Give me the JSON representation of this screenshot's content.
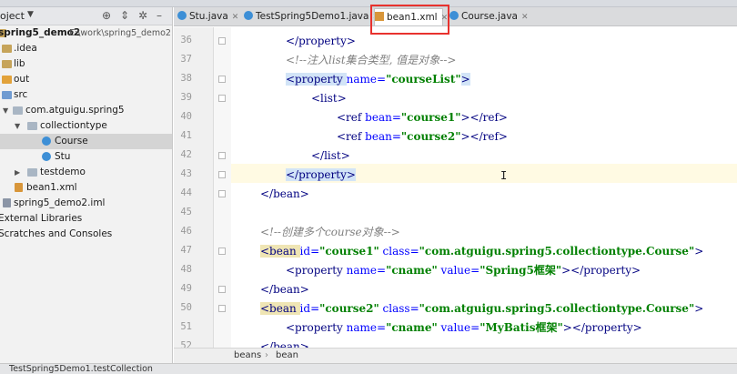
{
  "project_panel": {
    "title": "oject",
    "tree": [
      {
        "label": "spring5_demo2",
        "path": "E:\\work\\spring5_demo2",
        "icon": "folder-icon",
        "bold": true
      },
      {
        "label": ".idea",
        "icon": "folder-icon"
      },
      {
        "label": "lib",
        "icon": "folder-icon"
      },
      {
        "label": "out",
        "icon": "folder-icon"
      },
      {
        "label": "src",
        "icon": "folder-icon"
      },
      {
        "label": "com.atguigu.spring5",
        "icon": "package-icon"
      },
      {
        "label": "collectiontype",
        "icon": "package-icon"
      },
      {
        "label": "Course",
        "icon": "class-icon",
        "selected": true
      },
      {
        "label": "Stu",
        "icon": "class-icon"
      },
      {
        "label": "testdemo",
        "icon": "package-icon"
      },
      {
        "label": "bean1.xml",
        "icon": "xml-file-icon"
      },
      {
        "label": "spring5_demo2.iml",
        "icon": "iml-file-icon"
      },
      {
        "label": "External Libraries",
        "icon": "library-icon"
      },
      {
        "label": "Scratches and Consoles",
        "icon": "scratch-icon"
      }
    ]
  },
  "tabs": [
    {
      "label": "Stu.java",
      "icon": "class-icon",
      "active": false
    },
    {
      "label": "TestSpring5Demo1.java",
      "icon": "class-icon",
      "active": false
    },
    {
      "label": "bean1.xml",
      "icon": "xml-file-icon",
      "active": true
    },
    {
      "label": "Course.java",
      "icon": "class-icon",
      "active": false
    }
  ],
  "editor": {
    "lines": [
      {
        "n": "36",
        "text": "</property>"
      },
      {
        "n": "37",
        "text": "<!--注入list集合类型, 值是对象-->"
      },
      {
        "n": "38",
        "pre": "<property ",
        "attr": "name=",
        "val": "\"courseList\"",
        "post": ">"
      },
      {
        "n": "39",
        "text": "<list>"
      },
      {
        "n": "40",
        "pre": "<ref ",
        "attr": "bean=",
        "val": "\"course1\"",
        "post": "></ref>"
      },
      {
        "n": "41",
        "pre": "<ref ",
        "attr": "bean=",
        "val": "\"course2\"",
        "post": "></ref>"
      },
      {
        "n": "42",
        "text": "</list>"
      },
      {
        "n": "43",
        "text": "</property>"
      },
      {
        "n": "44",
        "text": "</bean>"
      },
      {
        "n": "45",
        "text": ""
      },
      {
        "n": "46",
        "text": "<!--创建多个course对象-->"
      },
      {
        "n": "47",
        "pre": "<bean ",
        "attr": "id=",
        "val": "\"course1\"",
        "attr2": " class=",
        "val2": "\"com.atguigu.spring5.collectiontype.Course\"",
        "post": ">"
      },
      {
        "n": "48",
        "pre": "<property ",
        "attr": "name=",
        "val": "\"cname\"",
        "attr2": " value=",
        "val2": "\"Spring5框架\"",
        "post": "></property>"
      },
      {
        "n": "49",
        "text": "</bean>"
      },
      {
        "n": "50",
        "pre": "<bean ",
        "attr": "id=",
        "val": "\"course2\"",
        "attr2": " class=",
        "val2": "\"com.atguigu.spring5.collectiontype.Course\"",
        "post": ">"
      },
      {
        "n": "51",
        "pre": "<property ",
        "attr": "name=",
        "val": "\"cname\"",
        "attr2": " value=",
        "val2": "\"MyBatis框架\"",
        "post": "></property>"
      },
      {
        "n": "52",
        "text": "</bean>"
      }
    ],
    "caret": "I"
  },
  "breadcrumbs": [
    "beans",
    "bean"
  ],
  "run_bar": "TestSpring5Demo1.testCollection",
  "colors": {
    "tag": "#000080",
    "attr": "#0000ff",
    "value": "#008000",
    "comment": "#808080",
    "highlight_box": "#e8322e"
  }
}
